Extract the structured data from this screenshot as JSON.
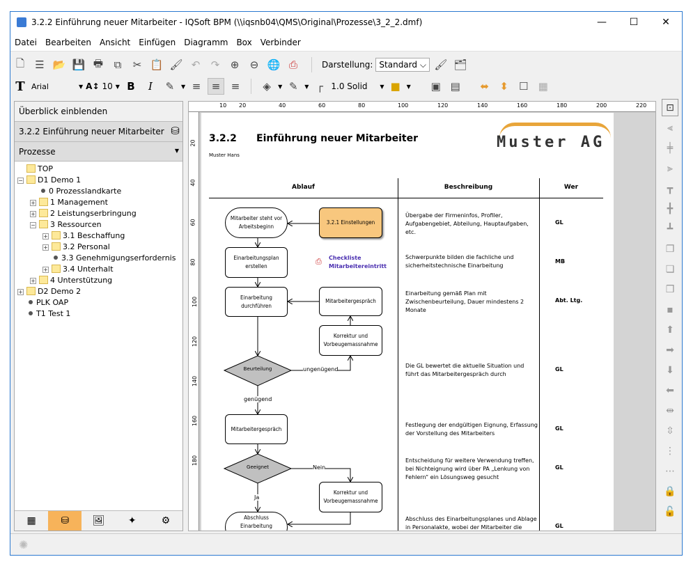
{
  "window": {
    "title": "3.2.2 Einführung neuer Mitarbeiter - IQSoft BPM (\\\\iqsnb04\\QMS\\Original\\Prozesse\\3_2_2.dmf)",
    "minimize": "—",
    "maximize": "☐",
    "close": "✕"
  },
  "menu": [
    "Datei",
    "Bearbeiten",
    "Ansicht",
    "Einfügen",
    "Diagramm",
    "Box",
    "Verbinder"
  ],
  "toolbar": {
    "darstellung_label": "Darstellung:",
    "darstellung_value": "Standard",
    "font": "Arial",
    "font_size": "10",
    "bold": "B",
    "italic": "I",
    "line_style": "1.0 Solid"
  },
  "left_panel": {
    "overview_button": "Überblick einblenden",
    "current": "3.2.2 Einführung neuer Mitarbeiter",
    "dropdown": "Prozesse",
    "tree": [
      {
        "label": "TOP",
        "level": 0,
        "type": "folder"
      },
      {
        "label": "D1 Demo 1",
        "level": 0,
        "type": "folder",
        "toggle": "−"
      },
      {
        "label": "0 Prozesslandkarte",
        "level": 1,
        "type": "leaf"
      },
      {
        "label": "1 Management",
        "level": 1,
        "type": "folder",
        "toggle": "+"
      },
      {
        "label": "2 Leistungserbringung",
        "level": 1,
        "type": "folder",
        "toggle": "+"
      },
      {
        "label": "3 Ressourcen",
        "level": 1,
        "type": "folder",
        "toggle": "−"
      },
      {
        "label": "3.1 Beschaffung",
        "level": 2,
        "type": "folder",
        "toggle": "+"
      },
      {
        "label": "3.2 Personal",
        "level": 2,
        "type": "folder",
        "toggle": "+"
      },
      {
        "label": "3.3 Genehmigungserfordernis",
        "level": 2,
        "type": "leaf"
      },
      {
        "label": "3.4 Unterhalt",
        "level": 2,
        "type": "folder",
        "toggle": "+"
      },
      {
        "label": "4 Unterstützung",
        "level": 1,
        "type": "folder",
        "toggle": "+"
      },
      {
        "label": "D2 Demo 2",
        "level": 0,
        "type": "folder",
        "toggle": "+"
      },
      {
        "label": "PLK OAP",
        "level": 0,
        "type": "leaf"
      },
      {
        "label": "T1 Test 1",
        "level": 0,
        "type": "leaf"
      }
    ]
  },
  "ruler": {
    "top": [
      "10",
      "20",
      "40",
      "60",
      "80",
      "100",
      "120",
      "140",
      "160",
      "180",
      "200",
      "220"
    ],
    "left": [
      "20",
      "40",
      "60",
      "80",
      "100",
      "120",
      "140",
      "160",
      "180"
    ]
  },
  "document": {
    "number": "3.2.2",
    "title": "Einführung neuer Mitarbeiter",
    "author": "Muster Hans",
    "logo": "Muster AG",
    "columns": [
      "Ablauf",
      "Beschreibung",
      "Wer"
    ],
    "shapes": {
      "start": "Mitarbeiter steht vor Arbeitsbeginn",
      "einstellungen": "3.2.1 Einstellungen",
      "plan": "Einarbeitungsplan erstellen",
      "checklist": "Checkliste Mitarbeitereintritt",
      "durchfuehren": "Einarbeitung durchführen",
      "gespraech1": "Mitarbeitergespräch",
      "korrektur1": "Korrektur und Vorbeugemassnahme",
      "beurteilung": "Beurteilung",
      "ungenuegend": "ungenügend",
      "genuegend": "genügend",
      "gespraech2": "Mitarbeitergespräch",
      "geeignet": "Geeignet",
      "nein": "Nein",
      "ja": "Ja",
      "korrektur2": "Korrektur und Vorbeugemassnahme",
      "abschluss": "Abschluss Einarbeitung"
    },
    "rows": [
      {
        "desc": "Übergabe der Firmeninfos, Profiler, Aufgabengebiet, Abteilung, Hauptaufgaben, etc.",
        "wer": "GL"
      },
      {
        "desc": "Schwerpunkte bilden die fachliche und sicherheitstechnische Einarbeitung",
        "wer": "MB"
      },
      {
        "desc": "Einarbeitung gemäß Plan mit Zwischenbeurteilung, Dauer mindestens 2 Monate",
        "wer": "Abt. Ltg."
      },
      {
        "desc": "Die GL bewertet die aktuelle Situation und führt das Mitarbeitergespräch durch",
        "wer": "GL"
      },
      {
        "desc": "Festlegung der endgültigen Eignung, Erfassung der Vorstellung des Mitarbeiters",
        "wer": "GL"
      },
      {
        "desc": "Entscheidung für weitere Verwendung treffen, bei Nichteignung wird über PA „Lenkung von Fehlern“ ein Lösungsweg gesucht",
        "wer": "GL"
      },
      {
        "desc": "Abschluss des Einarbeitungsplanes und Ablage in Personalakte, wobei der Mitarbeiter die",
        "wer": "GL"
      }
    ]
  },
  "colors": {
    "accent": "#2b79d0",
    "process_link": "#f8c77e",
    "link_text": "#4a2fb0",
    "decision": "#c0c0c0"
  }
}
